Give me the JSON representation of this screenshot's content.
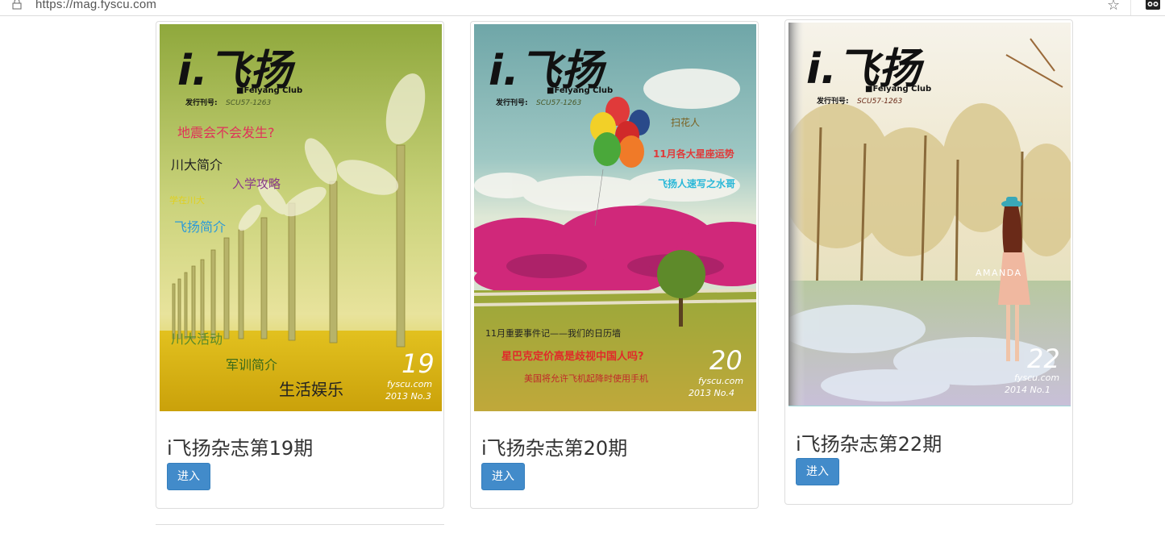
{
  "browser": {
    "url": "https://mag.fyscu.com"
  },
  "magazines": [
    {
      "title": "i飞扬杂志第19期",
      "button": "进入",
      "cover": {
        "logo": "i.飞扬",
        "club": "■Feiyang Club",
        "issue_label": "发行刊号:",
        "issue_code": "SCU57-1263",
        "issue_number": "19",
        "site": "fyscu.com",
        "year_no": "2013 No.3",
        "headlines": [
          "地震会不会发生?",
          "川大简介",
          "入学攻略",
          "学在川大",
          "飞扬简介",
          "川大活动",
          "军训简介",
          "生活娱乐"
        ]
      }
    },
    {
      "title": "i飞扬杂志第20期",
      "button": "进入",
      "cover": {
        "logo": "i.飞扬",
        "club": "■Feiyang Club",
        "issue_label": "发行刊号:",
        "issue_code": "SCU57-1263",
        "issue_number": "20",
        "site": "fyscu.com",
        "year_no": "2013 No.4",
        "headlines": [
          "扫花人",
          "11月各大星座运势",
          "飞扬人速写之水哥",
          "11月重要事件记——我们的日历墙",
          "星巴克定价高是歧视中国人吗?",
          "美国将允许飞机起降时使用手机"
        ]
      }
    },
    {
      "title": "i飞扬杂志第22期",
      "button": "进入",
      "cover": {
        "logo": "i.飞扬",
        "club": "■Feiyang Club",
        "issue_label": "发行刊号:",
        "issue_code": "SCU57-1263",
        "issue_number": "22",
        "site": "fyscu.com",
        "year_no": "2014 No.1",
        "headlines": [
          "AMANDA"
        ]
      }
    }
  ]
}
